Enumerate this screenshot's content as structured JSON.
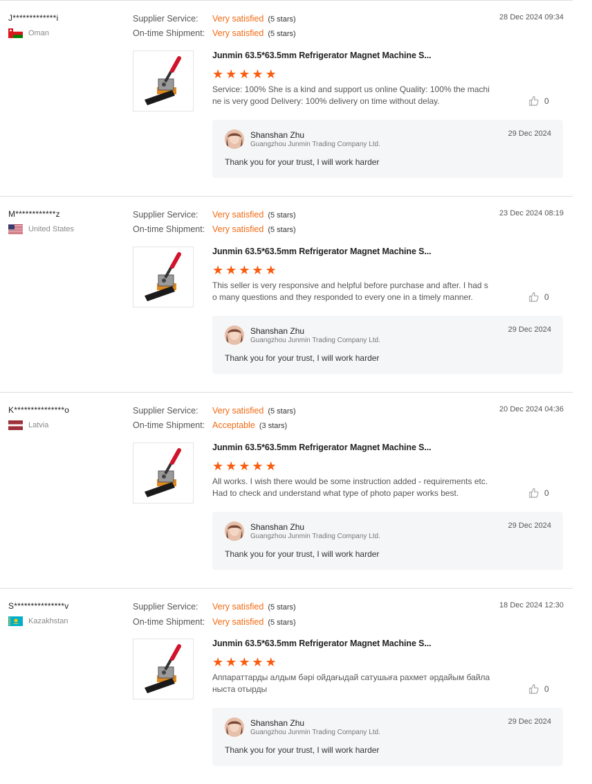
{
  "labels": {
    "supplier_service": "Supplier Service:",
    "ontime_shipment": "On-time Shipment:"
  },
  "colors": {
    "accent": "#f06a13",
    "star": "#f95d0f",
    "reply_bg": "#f5f6f8"
  },
  "reviews": [
    {
      "buyer": "J*************i",
      "country": "Oman",
      "flag": "oman-flag",
      "supplier_value": "Very satisfied",
      "supplier_stars": "(5 stars)",
      "shipment_value": "Very satisfied",
      "shipment_stars": "(5 stars)",
      "date": "28 Dec 2024 09:34",
      "product_title": "Junmin 63.5*63.5mm Refrigerator Magnet Machine S...",
      "product_rating": 5,
      "text": "Service: 100% She is a kind and support us online Quality: 100% the machine is very good Delivery: 100% delivery on time without delay.",
      "likes": "0",
      "reply": {
        "name": "Shanshan Zhu",
        "company": "Guangzhou Junmin Trading Company Ltd.",
        "date": "29 Dec 2024",
        "text": "Thank you for your trust, I will work harder"
      }
    },
    {
      "buyer": "M************z",
      "country": "United States",
      "flag": "us-flag",
      "supplier_value": "Very satisfied",
      "supplier_stars": "(5 stars)",
      "shipment_value": "Very satisfied",
      "shipment_stars": "(5 stars)",
      "date": "23 Dec 2024 08:19",
      "product_title": "Junmin 63.5*63.5mm Refrigerator Magnet Machine S...",
      "product_rating": 5,
      "text": "This seller is very responsive and helpful before purchase and after. I had so many questions and they responded to every one in a timely manner.",
      "likes": "0",
      "reply": {
        "name": "Shanshan Zhu",
        "company": "Guangzhou Junmin Trading Company Ltd.",
        "date": "29 Dec 2024",
        "text": "Thank you for your trust, I will work harder"
      }
    },
    {
      "buyer": "K***************o",
      "country": "Latvia",
      "flag": "latvia-flag",
      "supplier_value": "Very satisfied",
      "supplier_stars": "(5 stars)",
      "shipment_value": "Acceptable",
      "shipment_stars": "(3 stars)",
      "date": "20 Dec 2024 04:36",
      "product_title": "Junmin 63.5*63.5mm Refrigerator Magnet Machine S...",
      "product_rating": 5,
      "text": "All works. I wish there would be some instruction added - requirements etc. Had to check and understand what type of photo paper works best.",
      "likes": "0",
      "reply": {
        "name": "Shanshan Zhu",
        "company": "Guangzhou Junmin Trading Company Ltd.",
        "date": "29 Dec 2024",
        "text": "Thank you for your trust, I will work harder"
      }
    },
    {
      "buyer": "S***************v",
      "country": "Kazakhstan",
      "flag": "kazakhstan-flag",
      "supplier_value": "Very satisfied",
      "supplier_stars": "(5 stars)",
      "shipment_value": "Very satisfied",
      "shipment_stars": "(5 stars)",
      "date": "18 Dec 2024 12:30",
      "product_title": "Junmin 63.5*63.5mm Refrigerator Magnet Machine S...",
      "product_rating": 5,
      "text": "Аппараттарды алдым бәрі ойдағыдай сатушыға рахмет әрдайым байланыста отырды",
      "likes": "0",
      "reply": {
        "name": "Shanshan Zhu",
        "company": "Guangzhou Junmin Trading Company Ltd.",
        "date": "29 Dec 2024",
        "text": "Thank you for your trust, I will work harder"
      }
    }
  ]
}
